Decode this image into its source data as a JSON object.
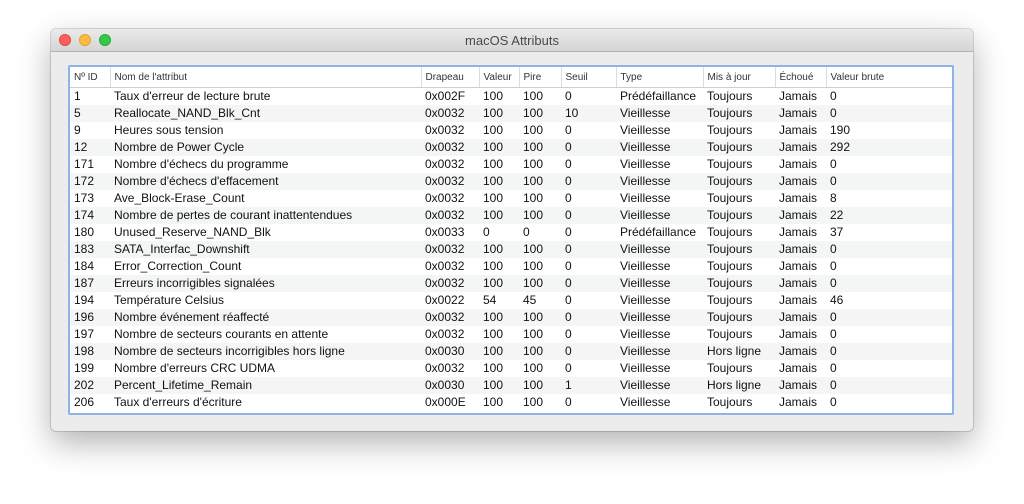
{
  "window": {
    "title": "macOS Attributs"
  },
  "table": {
    "columns": [
      "Nº ID",
      "Nom de l'attribut",
      "Drapeau",
      "Valeur",
      "Pire",
      "Seuil",
      "Type",
      "Mis à jour",
      "Échoué",
      "Valeur brute"
    ],
    "rows": [
      [
        "1",
        "Taux d'erreur de lecture brute",
        "0x002F",
        "100",
        "100",
        "0",
        "Prédéfaillance",
        "Toujours",
        "Jamais",
        "0"
      ],
      [
        "5",
        "Reallocate_NAND_Blk_Cnt",
        "0x0032",
        "100",
        "100",
        "10",
        "Vieillesse",
        "Toujours",
        "Jamais",
        "0"
      ],
      [
        "9",
        "Heures sous tension",
        "0x0032",
        "100",
        "100",
        "0",
        "Vieillesse",
        "Toujours",
        "Jamais",
        "190"
      ],
      [
        "12",
        "Nombre de Power Cycle",
        "0x0032",
        "100",
        "100",
        "0",
        "Vieillesse",
        "Toujours",
        "Jamais",
        "292"
      ],
      [
        "171",
        "Nombre d'échecs du programme",
        "0x0032",
        "100",
        "100",
        "0",
        "Vieillesse",
        "Toujours",
        "Jamais",
        "0"
      ],
      [
        "172",
        "Nombre d'échecs d'effacement",
        "0x0032",
        "100",
        "100",
        "0",
        "Vieillesse",
        "Toujours",
        "Jamais",
        "0"
      ],
      [
        "173",
        "Ave_Block-Erase_Count",
        "0x0032",
        "100",
        "100",
        "0",
        "Vieillesse",
        "Toujours",
        "Jamais",
        "8"
      ],
      [
        "174",
        "Nombre  de pertes de courant inattentendues",
        "0x0032",
        "100",
        "100",
        "0",
        "Vieillesse",
        "Toujours",
        "Jamais",
        "22"
      ],
      [
        "180",
        "Unused_Reserve_NAND_Blk",
        "0x0033",
        "0",
        "0",
        "0",
        "Prédéfaillance",
        "Toujours",
        "Jamais",
        "37"
      ],
      [
        "183",
        "SATA_Interfac_Downshift",
        "0x0032",
        "100",
        "100",
        "0",
        "Vieillesse",
        "Toujours",
        "Jamais",
        "0"
      ],
      [
        "184",
        "Error_Correction_Count",
        "0x0032",
        "100",
        "100",
        "0",
        "Vieillesse",
        "Toujours",
        "Jamais",
        "0"
      ],
      [
        "187",
        "Erreurs incorrigibles signalées",
        "0x0032",
        "100",
        "100",
        "0",
        "Vieillesse",
        "Toujours",
        "Jamais",
        "0"
      ],
      [
        "194",
        "Température Celsius",
        "0x0022",
        "54",
        "45",
        "0",
        "Vieillesse",
        "Toujours",
        "Jamais",
        "46"
      ],
      [
        "196",
        "Nombre événement réaffecté",
        "0x0032",
        "100",
        "100",
        "0",
        "Vieillesse",
        "Toujours",
        "Jamais",
        "0"
      ],
      [
        "197",
        "Nombre de secteurs courants en attente",
        "0x0032",
        "100",
        "100",
        "0",
        "Vieillesse",
        "Toujours",
        "Jamais",
        "0"
      ],
      [
        "198",
        "Nombre de secteurs incorrigibles hors ligne",
        "0x0030",
        "100",
        "100",
        "0",
        "Vieillesse",
        "Hors ligne",
        "Jamais",
        "0"
      ],
      [
        "199",
        "Nombre d'erreurs CRC UDMA",
        "0x0032",
        "100",
        "100",
        "0",
        "Vieillesse",
        "Toujours",
        "Jamais",
        "0"
      ],
      [
        "202",
        "Percent_Lifetime_Remain",
        "0x0030",
        "100",
        "100",
        "1",
        "Vieillesse",
        "Hors ligne",
        "Jamais",
        "0"
      ],
      [
        "206",
        "Taux d'erreurs d'écriture",
        "0x000E",
        "100",
        "100",
        "0",
        "Vieillesse",
        "Toujours",
        "Jamais",
        "0"
      ]
    ]
  }
}
